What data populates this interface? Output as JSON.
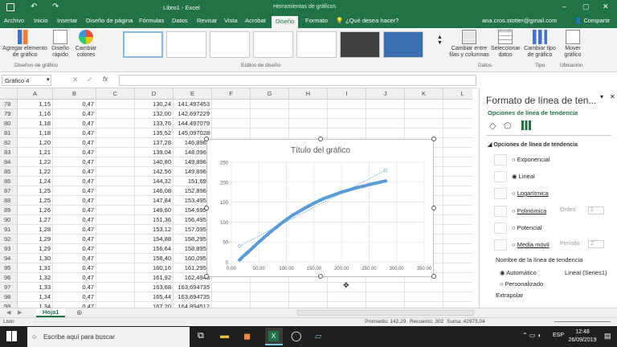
{
  "window": {
    "title": "Libro1 - Excel",
    "context_tab": "Herramientas de gráficos"
  },
  "tabs": [
    {
      "label": "Archivo"
    },
    {
      "label": "Inicio"
    },
    {
      "label": "Insertar"
    },
    {
      "label": "Diseño de página"
    },
    {
      "label": "Fórmulas"
    },
    {
      "label": "Datos"
    },
    {
      "label": "Revisar"
    },
    {
      "label": "Vista"
    },
    {
      "label": "Acrobat"
    },
    {
      "label": "Diseño"
    },
    {
      "label": "Formato"
    }
  ],
  "tellme": "¿Qué desea hacer?",
  "user": {
    "email": "ana.cros.stotter@gmail.com",
    "share": "Compartir"
  },
  "ribbon": {
    "add_element": "Agregar elemento de gráfico",
    "quick_layout": "Diseño rápido",
    "change_colors": "Cambiar colores",
    "group_layouts": "Diseños de gráfico",
    "group_styles": "Estilos de diseño",
    "switch_rowcol": "Cambiar entre filas y columnas",
    "select_data": "Seleccionar datos",
    "group_data": "Datos",
    "change_type": "Cambiar tipo de gráfico",
    "group_type": "Tipo",
    "move_chart": "Mover gráfico",
    "group_location": "Ubicación"
  },
  "namebox": "Gráfico 4",
  "columns": [
    "A",
    "B",
    "C",
    "D",
    "E",
    "F",
    "G",
    "H",
    "I",
    "J",
    "K",
    "L"
  ],
  "rows": [
    {
      "n": "78",
      "a": "1,15",
      "b": "0,47",
      "d": "130,24",
      "e": "141,497453"
    },
    {
      "n": "79",
      "a": "1,16",
      "b": "0,47",
      "d": "132,00",
      "e": "142,697229"
    },
    {
      "n": "80",
      "a": "1,18",
      "b": "0,47",
      "d": "133,76",
      "e": "144,497079"
    },
    {
      "n": "81",
      "a": "1,18",
      "b": "0,47",
      "d": "135,52",
      "e": "145,097028"
    },
    {
      "n": "82",
      "a": "1,20",
      "b": "0,47",
      "d": "137,28",
      "e": "146,8967"
    },
    {
      "n": "83",
      "a": "1,21",
      "b": "0,47",
      "d": "139,04",
      "e": "148,0966"
    },
    {
      "n": "84",
      "a": "1,22",
      "b": "0,47",
      "d": "140,80",
      "e": "149,8963"
    },
    {
      "n": "85",
      "a": "1,22",
      "b": "0,47",
      "d": "142,56",
      "e": "149,8963"
    },
    {
      "n": "86",
      "a": "1,24",
      "b": "0,47",
      "d": "144,32",
      "e": "151,696"
    },
    {
      "n": "87",
      "a": "1,25",
      "b": "0,47",
      "d": "146,08",
      "e": "152,8960"
    },
    {
      "n": "88",
      "a": "1,25",
      "b": "0,47",
      "d": "147,84",
      "e": "153,4959"
    },
    {
      "n": "89",
      "a": "1,26",
      "b": "0,47",
      "d": "149,60",
      "e": "154,6957"
    },
    {
      "n": "90",
      "a": "1,27",
      "b": "0,47",
      "d": "151,36",
      "e": "156,4955"
    },
    {
      "n": "91",
      "a": "1,28",
      "b": "0,47",
      "d": "153,12",
      "e": "157,0955"
    },
    {
      "n": "92",
      "a": "1,29",
      "b": "0,47",
      "d": "154,88",
      "e": "158,2954"
    },
    {
      "n": "93",
      "a": "1,29",
      "b": "0,47",
      "d": "156,64",
      "e": "158,8952"
    },
    {
      "n": "94",
      "a": "1,30",
      "b": "0,47",
      "d": "158,40",
      "e": "160,0951"
    },
    {
      "n": "95",
      "a": "1,31",
      "b": "0,47",
      "d": "160,16",
      "e": "161,2950"
    },
    {
      "n": "96",
      "a": "1,32",
      "b": "0,47",
      "d": "161,92",
      "e": "162,4948"
    },
    {
      "n": "97",
      "a": "1,33",
      "b": "0,47",
      "d": "163,68",
      "e": "163,694735"
    },
    {
      "n": "98",
      "a": "1,34",
      "b": "0,47",
      "d": "165,44",
      "e": "163,694735"
    },
    {
      "n": "99",
      "a": "1,34",
      "b": "0,47",
      "d": "167,20",
      "e": "164,894512"
    }
  ],
  "sheet_tab": "Hoja1",
  "status": {
    "mode": "Listo",
    "avg": "Promedio: 142,29",
    "count": "Recuento: 302",
    "sum": "Suma: 42973,04"
  },
  "pane": {
    "title": "Formato de línea de ten...",
    "subtitle": "Opciones de línea de tendencia",
    "section": "Opciones de línea de tendencia",
    "options": [
      "Exponencial",
      "Lineal",
      "Logarítmica",
      "Polinómica",
      "Potencial",
      "Media móvil"
    ],
    "order_label": "Orden",
    "period_label": "Período",
    "order_value": "2",
    "period_value": "2",
    "name_label": "Nombre de la línea de tendencia",
    "auto_label": "Automático",
    "auto_value": "Lineal (Series1)",
    "custom_label": "Personalizado",
    "extrapolate": "Extrapolar"
  },
  "taskbar": {
    "search": "Escribe aquí para buscar",
    "lang": "ESP",
    "time": "12:48",
    "date": "26/09/2019"
  },
  "chart_data": {
    "type": "scatter",
    "title": "Título del gráfico",
    "xlim": [
      0,
      350
    ],
    "ylim": [
      0,
      250
    ],
    "x_ticks": [
      "0,00",
      "50,00",
      "100,00",
      "150,00",
      "200,00",
      "250,00",
      "300,00",
      "350,00"
    ],
    "y_ticks": [
      "0",
      "50",
      "100",
      "150",
      "200",
      "250"
    ],
    "grid": true,
    "series": [
      {
        "x": [
          15,
          20,
          30,
          40,
          50,
          60,
          70,
          80,
          90,
          100,
          110,
          120,
          130,
          140,
          150,
          160,
          170,
          180,
          190,
          200,
          210,
          220,
          230,
          240,
          250,
          260,
          270,
          280
        ],
        "y": [
          5,
          12,
          24,
          37,
          50,
          62,
          74,
          85,
          96,
          106,
          116,
          124,
          132,
          140,
          147,
          154,
          160,
          165,
          170,
          175,
          179,
          183,
          187,
          190,
          194,
          197,
          200,
          203
        ]
      }
    ],
    "trendline": {
      "type": "linear",
      "x": [
        15,
        280
      ],
      "y": [
        40,
        230
      ]
    }
  }
}
